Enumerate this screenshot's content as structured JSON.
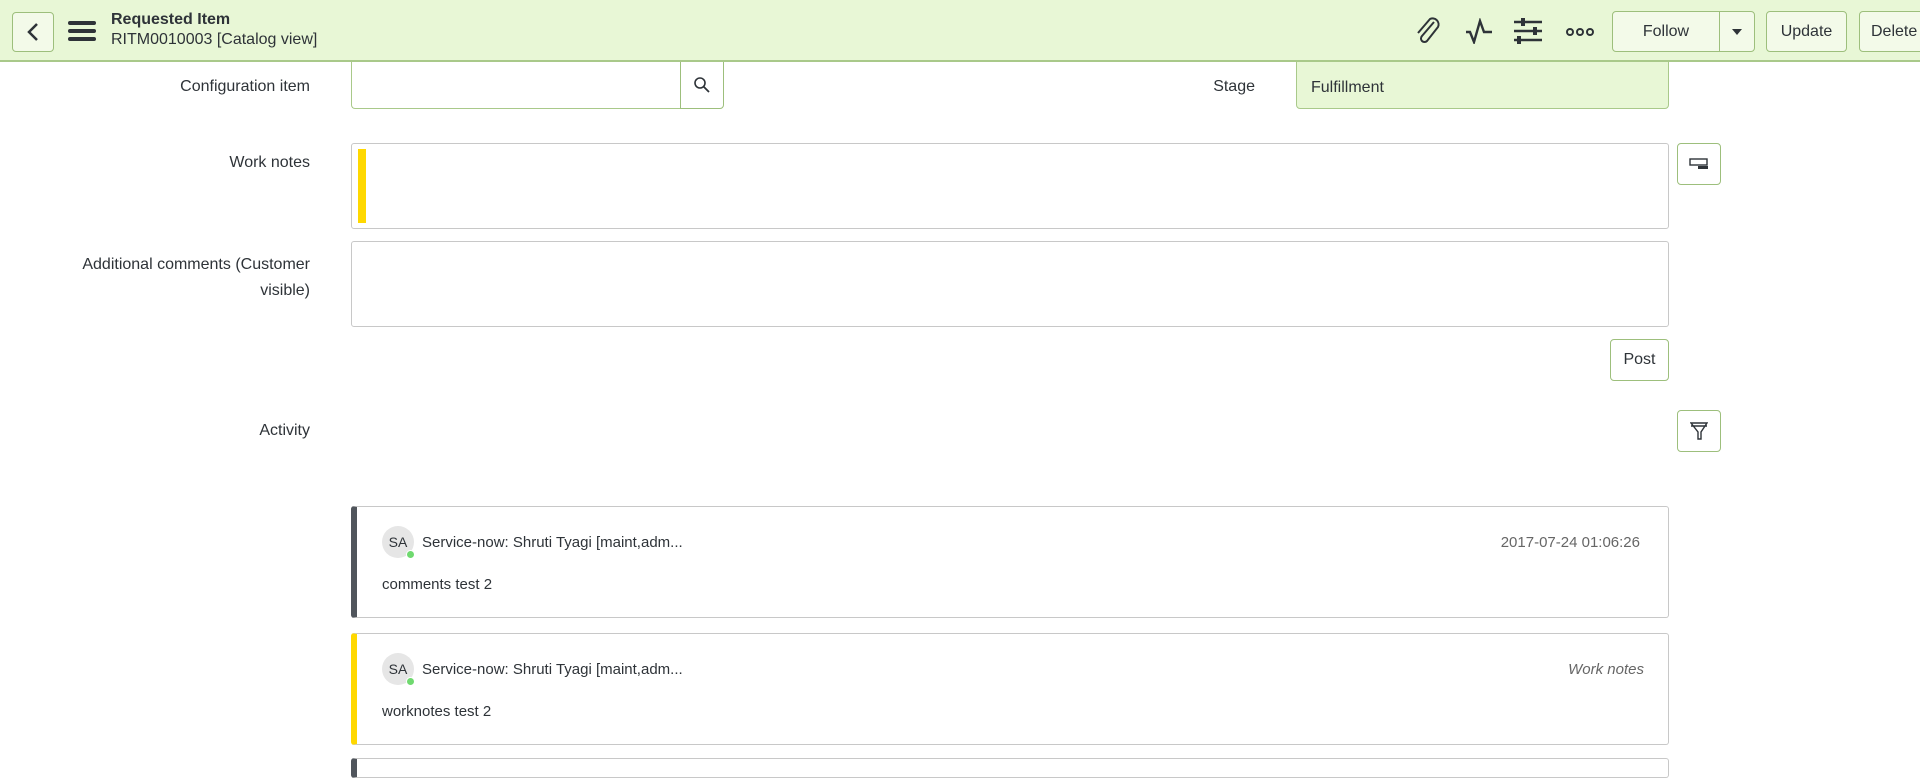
{
  "header": {
    "title": "Requested Item",
    "subtitle": "RITM0010003 [Catalog view]",
    "follow_label": "Follow",
    "update_label": "Update",
    "delete_label": "Delete"
  },
  "form": {
    "config_item_label": "Configuration item",
    "config_item_value": "",
    "stage_label": "Stage",
    "stage_value": "Fulfillment",
    "work_notes_label": "Work notes",
    "additional_comments_label_1": "Additional comments (Customer",
    "additional_comments_label_2": "visible)",
    "post_label": "Post",
    "activity_label": "Activity"
  },
  "activity": [
    {
      "initials": "SA",
      "author": "Service-now: Shruti Tyagi [maint,adm...",
      "meta": "2017-07-24 01:06:26",
      "text": "comments test 2",
      "accent": "#50555c"
    },
    {
      "initials": "SA",
      "author": "Service-now: Shruti Tyagi [maint,adm...",
      "meta": "Work notes",
      "text": "worknotes test 2",
      "accent": "#ffd800"
    }
  ]
}
